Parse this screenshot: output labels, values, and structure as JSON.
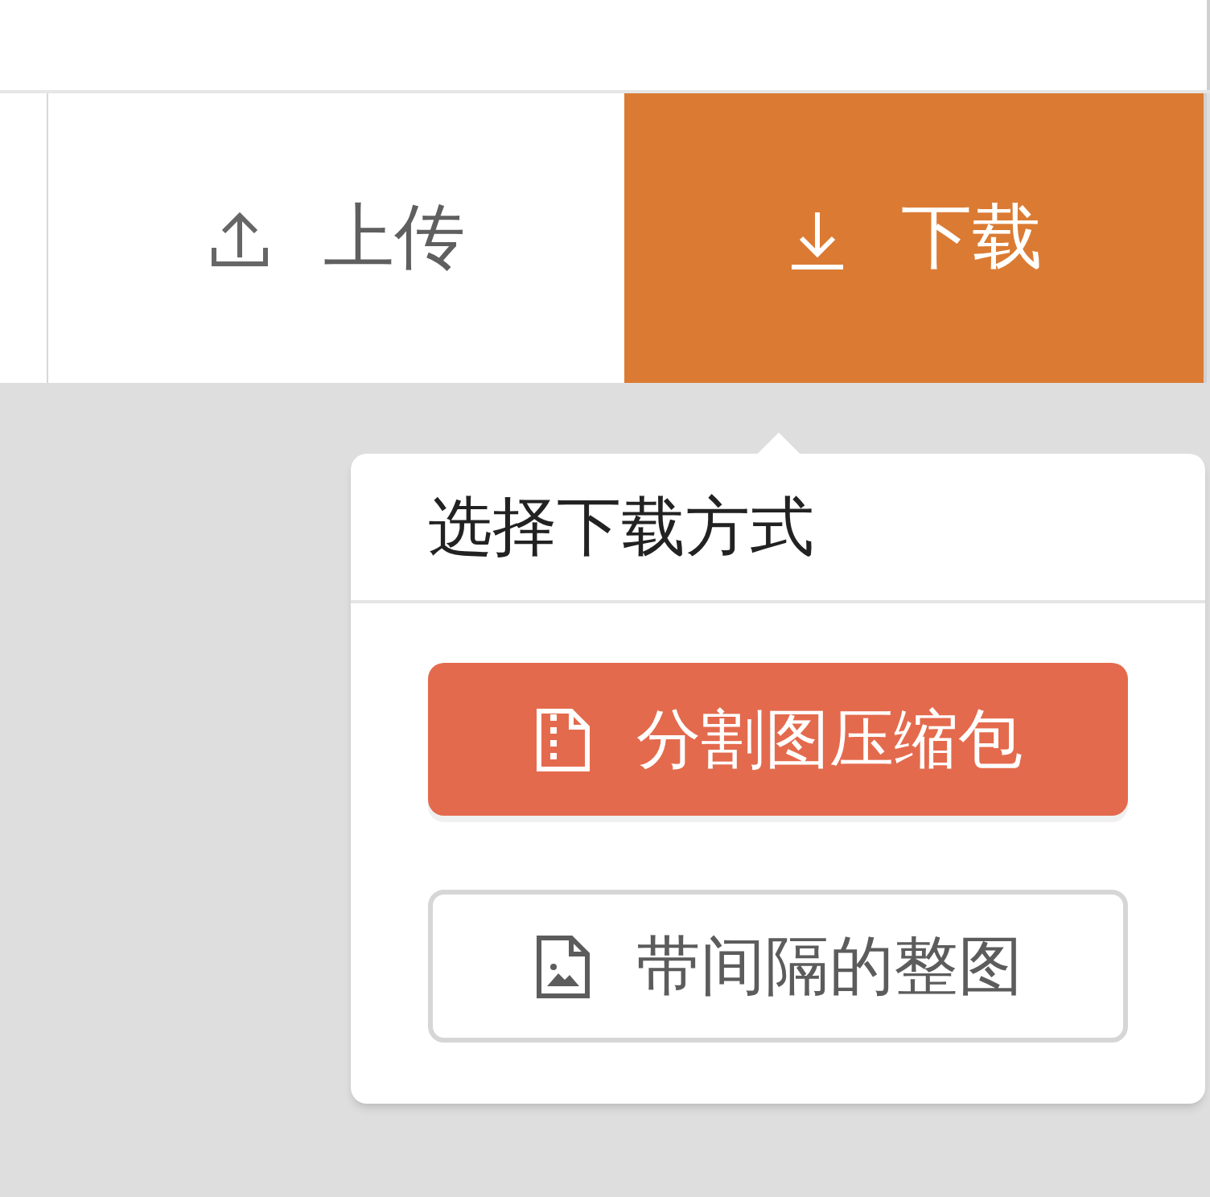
{
  "actions": [
    {
      "kind": "upload",
      "label": "上传",
      "selected": false
    },
    {
      "kind": "download",
      "label": "下载",
      "selected": true
    }
  ],
  "popover": {
    "title": "选择下载方式",
    "options": [
      {
        "kind": "archive",
        "label": "分割图压缩包",
        "primary": true
      },
      {
        "kind": "image",
        "label": "带间隔的整图",
        "primary": false
      }
    ]
  }
}
